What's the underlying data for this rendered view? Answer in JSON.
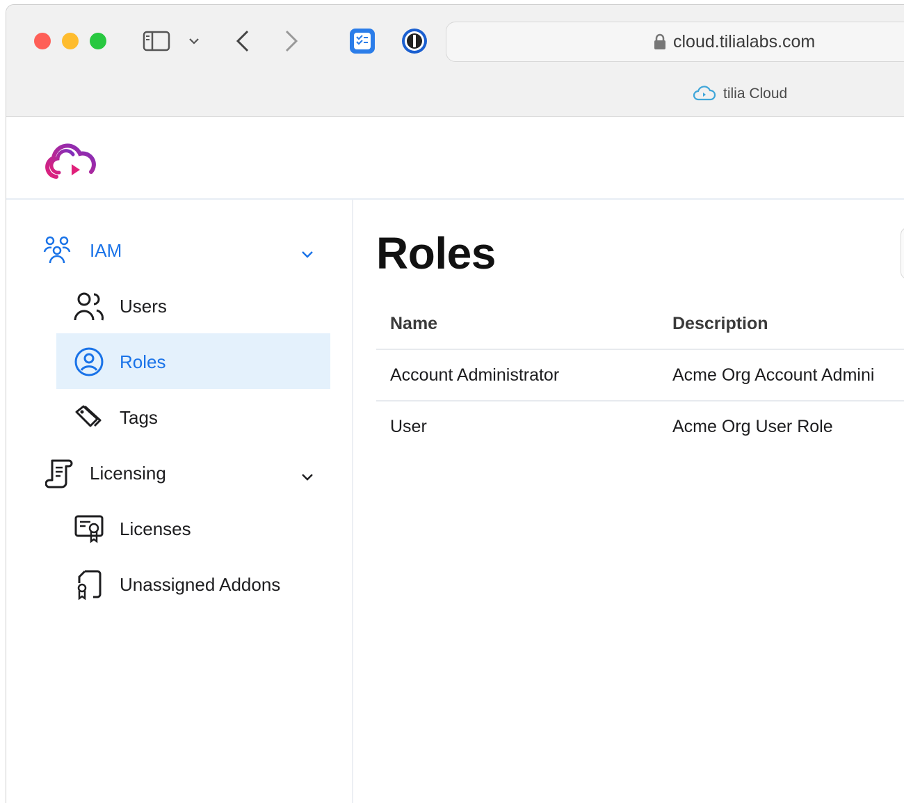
{
  "browser": {
    "url": "cloud.tilialabs.com",
    "tab_title": "tilia Cloud"
  },
  "sidebar": {
    "groups": [
      {
        "label": "IAM",
        "icon": "people-group-icon",
        "items": [
          {
            "label": "Users",
            "icon": "users-icon"
          },
          {
            "label": "Roles",
            "icon": "user-circle-icon",
            "selected": true
          },
          {
            "label": "Tags",
            "icon": "tags-icon"
          }
        ]
      },
      {
        "label": "Licensing",
        "icon": "scroll-icon",
        "items": [
          {
            "label": "Licenses",
            "icon": "certificate-icon"
          },
          {
            "label": "Unassigned Addons",
            "icon": "document-badge-icon"
          }
        ]
      }
    ]
  },
  "main": {
    "title": "Roles",
    "table": {
      "columns": [
        "Name",
        "Description"
      ],
      "rows": [
        [
          "Account Administrator",
          "Acme Org Account Admini"
        ],
        [
          "User",
          "Acme Org User Role"
        ]
      ]
    }
  },
  "colors": {
    "accent": "#1a73e8",
    "selected_bg": "#e4f1fc",
    "logo_gradient": [
      "#e0207a",
      "#7b2fbe"
    ]
  }
}
